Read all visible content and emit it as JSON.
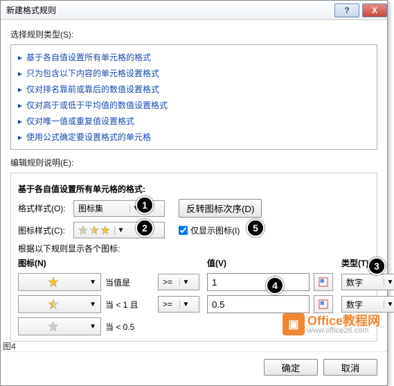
{
  "dialog": {
    "title": "新建格式规则",
    "help": "?",
    "close": "X"
  },
  "select_rule_type_label": "选择规则类型(S):",
  "rule_types": [
    "基于各自值设置所有单元格的格式",
    "只为包含以下内容的单元格设置格式",
    "仅对排名靠前或靠后的数值设置格式",
    "仅对高于或低于平均值的数值设置格式",
    "仅对唯一值或重复值设置格式",
    "使用公式确定要设置格式的单元格"
  ],
  "edit_rule_desc_label": "编辑规则说明(E):",
  "format_all_label": "基于各自值设置所有单元格的格式:",
  "format_style_label": "格式样式(O):",
  "format_style_value": "图标集",
  "reverse_order_btn": "反转图标次序(D)",
  "icon_style_label": "图标样式(C):",
  "show_icon_only_label": "仅显示图标(I)",
  "rules_caption": "根据以下规则显示各个图标:",
  "col_icon": "图标(N)",
  "col_value": "值(V)",
  "col_type": "类型(T)",
  "rows": [
    {
      "cond": "当值是",
      "op": ">=",
      "val": "1",
      "type": "数字",
      "star": "gold"
    },
    {
      "cond": "当 < 1 且",
      "op": ">=",
      "val": "0.5",
      "type": "数字",
      "star": "half"
    },
    {
      "cond": "当 < 0.5",
      "star": "gray"
    }
  ],
  "ok": "确定",
  "cancel": "取消",
  "badges": {
    "b1": "1",
    "b2": "2",
    "b3": "3",
    "b4": "4",
    "b5": "5"
  },
  "watermark": {
    "brand": "Office教程网",
    "url": "www.office26.com"
  },
  "caption": "图4",
  "star_colors": {
    "gold": "#f5c037",
    "gray": "#cfcfcf"
  }
}
